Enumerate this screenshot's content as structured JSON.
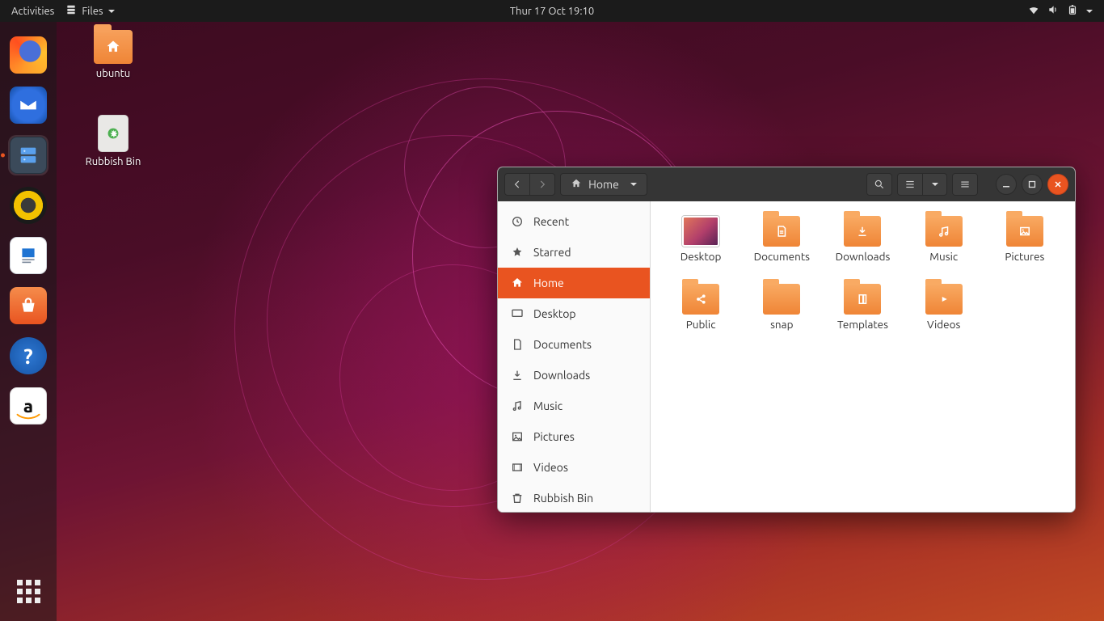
{
  "topbar": {
    "activities": "Activities",
    "app_menu": "Files",
    "clock": "Thur 17 Oct 19:10"
  },
  "desktop_icons": [
    {
      "name": "ubuntu",
      "kind": "home-folder"
    },
    {
      "name": "Rubbish Bin",
      "kind": "trash"
    }
  ],
  "dock": {
    "items": [
      {
        "name": "firefox",
        "running": false
      },
      {
        "name": "thunderbird",
        "running": false
      },
      {
        "name": "files",
        "running": true,
        "active": true
      },
      {
        "name": "rhythmbox",
        "running": false
      },
      {
        "name": "libreoffice-writer",
        "running": false
      },
      {
        "name": "ubuntu-software",
        "running": false
      },
      {
        "name": "help",
        "running": false
      },
      {
        "name": "amazon",
        "running": false
      }
    ]
  },
  "files_window": {
    "path_label": "Home",
    "sidebar": [
      {
        "label": "Recent",
        "icon": "clock"
      },
      {
        "label": "Starred",
        "icon": "star"
      },
      {
        "label": "Home",
        "icon": "home",
        "selected": true
      },
      {
        "label": "Desktop",
        "icon": "desktop"
      },
      {
        "label": "Documents",
        "icon": "documents"
      },
      {
        "label": "Downloads",
        "icon": "downloads"
      },
      {
        "label": "Music",
        "icon": "music"
      },
      {
        "label": "Pictures",
        "icon": "pictures"
      },
      {
        "label": "Videos",
        "icon": "videos"
      },
      {
        "label": "Rubbish Bin",
        "icon": "trash"
      }
    ],
    "items": [
      {
        "label": "Desktop",
        "icon": "desktop-thumb"
      },
      {
        "label": "Documents",
        "icon": "documents"
      },
      {
        "label": "Downloads",
        "icon": "downloads"
      },
      {
        "label": "Music",
        "icon": "music"
      },
      {
        "label": "Pictures",
        "icon": "pictures"
      },
      {
        "label": "Public",
        "icon": "public"
      },
      {
        "label": "snap",
        "icon": "plain"
      },
      {
        "label": "Templates",
        "icon": "templates"
      },
      {
        "label": "Videos",
        "icon": "videos"
      }
    ]
  }
}
